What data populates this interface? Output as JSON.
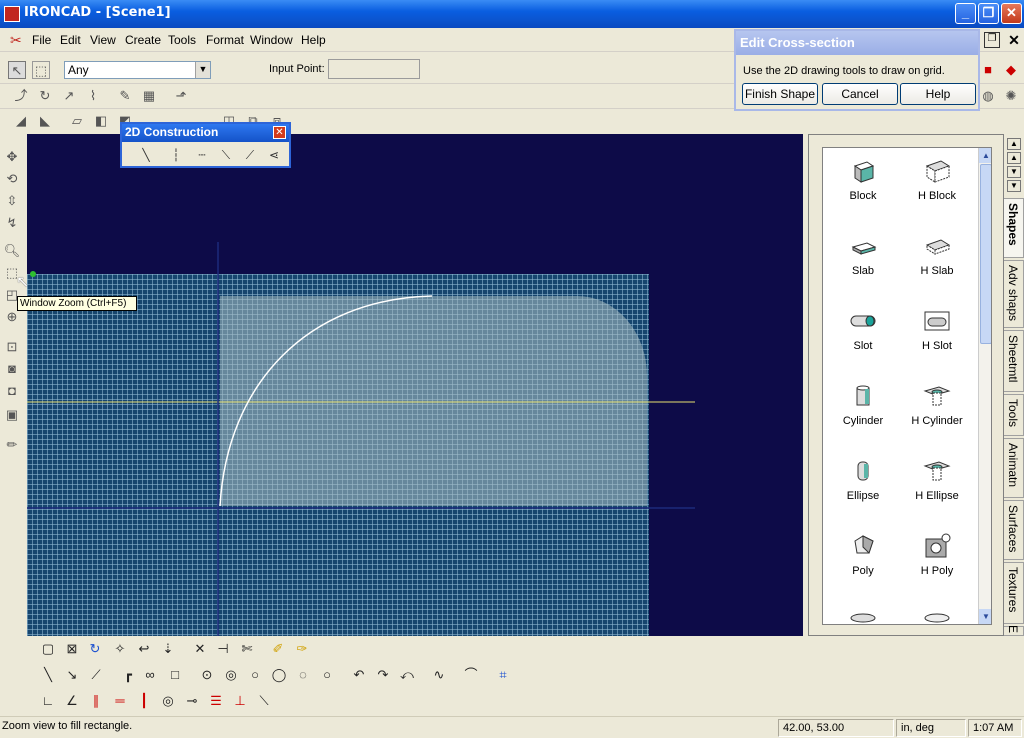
{
  "window": {
    "title": "IRONCAD - [Scene1]"
  },
  "menu": [
    "File",
    "Edit",
    "View",
    "Create",
    "Tools",
    "Format",
    "Window",
    "Help"
  ],
  "selection_toolbar": {
    "filter_value": "Any",
    "input_point_label": "Input Point:",
    "input_point_value": ""
  },
  "palette": {
    "title": "2D Construction"
  },
  "dialog": {
    "title": "Edit Cross-section",
    "message": "Use the 2D drawing tools to draw on grid.",
    "finish_label": "Finish Shape",
    "cancel_label": "Cancel",
    "help_label": "Help"
  },
  "tooltip": {
    "text": "Window Zoom (Ctrl+F5)"
  },
  "catalog": {
    "items": [
      {
        "left": "Block",
        "right": "H Block"
      },
      {
        "left": "Slab",
        "right": "H Slab"
      },
      {
        "left": "Slot",
        "right": "H Slot"
      },
      {
        "left": "Cylinder",
        "right": "H Cylinder"
      },
      {
        "left": "Ellipse",
        "right": "H Ellipse"
      },
      {
        "left": "Poly",
        "right": "H Poly"
      }
    ]
  },
  "tabs": [
    "Shapes",
    "Adv shaps",
    "Sheetmtl",
    "Tools",
    "Animatn",
    "Surfaces",
    "Textures",
    "E"
  ],
  "status": {
    "message": "Zoom view to fill rectangle.",
    "coords": "42.00, 53.00",
    "units": "in, deg",
    "time": "1:07 AM"
  },
  "colors": {
    "viewport": "#0d0b48",
    "grid": "#16456e",
    "accent": "#0a5ee0",
    "axis": "#e8e070"
  }
}
